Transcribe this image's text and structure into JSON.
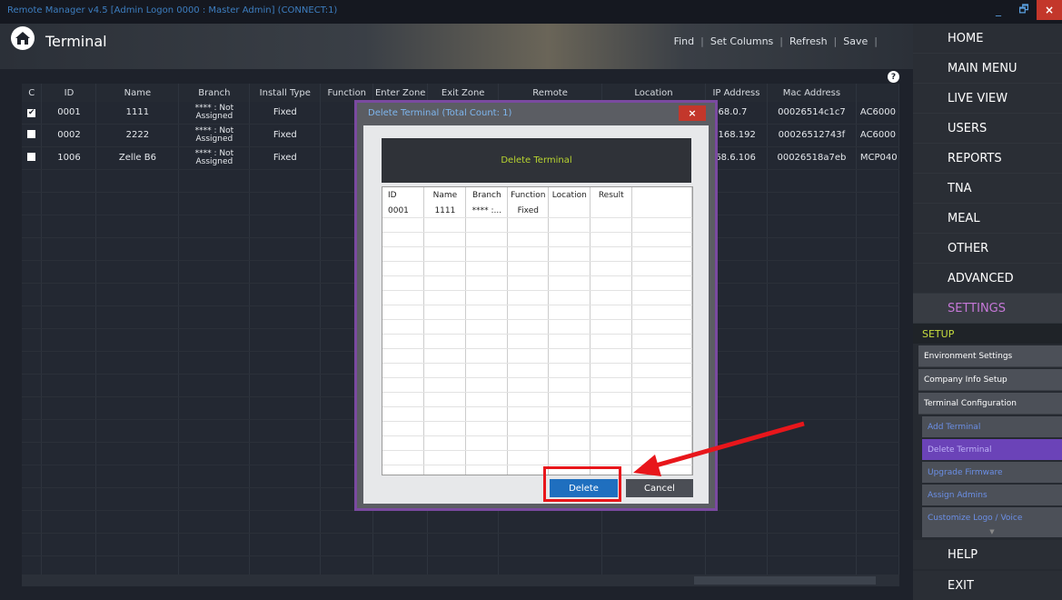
{
  "window": {
    "title": "Remote Manager v4.5 [Admin Logon 0000 : Master Admin] (CONNECT:1)",
    "minimize": "_",
    "restore": "🗗",
    "close": "×"
  },
  "header": {
    "title": "Terminal",
    "toolbar": [
      "Find",
      "Set Columns",
      "Refresh",
      "Save"
    ],
    "help": "?"
  },
  "grid": {
    "columns": [
      "C",
      "ID",
      "Name",
      "Branch",
      "Install Type",
      "Function",
      "Enter Zone",
      "Exit Zone",
      "Remote",
      "Location",
      "IP Address",
      "Mac Address",
      ""
    ],
    "rows": [
      {
        "checked": true,
        "id": "0001",
        "name": "1111",
        "branch_line1": "**** : Not",
        "branch_line2": "Assigned",
        "install_type": "Fixed",
        "ip": ".168.0.7",
        "mac": "00026514c1c7",
        "model": "AC6000"
      },
      {
        "checked": false,
        "id": "0002",
        "name": "2222",
        "branch_line1": "**** : Not",
        "branch_line2": "Assigned",
        "install_type": "Fixed",
        "ip": "0.168.192",
        "mac": "00026512743f",
        "model": "AC6000"
      },
      {
        "checked": false,
        "id": "1006",
        "name": "Zelle B6",
        "branch_line1": "**** : Not",
        "branch_line2": "Assigned",
        "install_type": "Fixed",
        "ip": "168.6.106",
        "mac": "00026518a7eb",
        "model": "MCP040"
      }
    ]
  },
  "nav": {
    "items": [
      "HOME",
      "MAIN MENU",
      "LIVE VIEW",
      "USERS",
      "REPORTS",
      "TNA",
      "MEAL",
      "OTHER",
      "ADVANCED",
      "SETTINGS"
    ],
    "active": "SETTINGS",
    "section": "SETUP",
    "sub_items": [
      "Environment Settings",
      "Company Info Setup",
      "Terminal Configuration"
    ],
    "terminal_sub_items": [
      "Add Terminal",
      "Delete Terminal",
      "Upgrade Firmware",
      "Assign Admins",
      "Customize Logo / Voice"
    ],
    "active_sub": "Delete Terminal",
    "more": "▼",
    "bottom": [
      "HELP",
      "EXIT"
    ]
  },
  "dialog": {
    "title": "Delete Terminal (Total Count: 1)",
    "close": "×",
    "banner": "Delete Terminal",
    "columns": [
      "ID",
      "Name",
      "Branch",
      "Function",
      "Location",
      "Result"
    ],
    "rows": [
      {
        "id": "0001",
        "name": "1111",
        "branch": "**** :...",
        "function": "Fixed",
        "location": "",
        "result": ""
      }
    ],
    "delete_label": "Delete",
    "cancel_label": "Cancel"
  },
  "colors": {
    "accent": "#1f6fbf",
    "highlight": "#e8161b",
    "active_nav": "#c678d8",
    "setup": "#c6dc3e"
  }
}
